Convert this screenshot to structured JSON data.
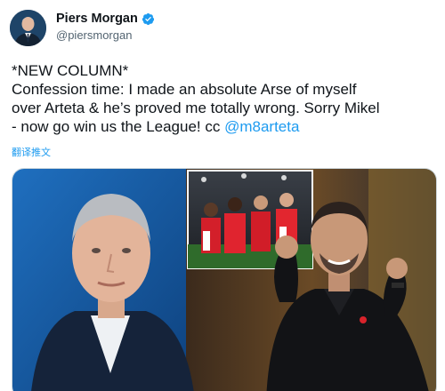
{
  "author": {
    "name": "Piers Morgan",
    "handle": "@piersmorgan",
    "verified_icon": "verified-badge-icon",
    "avatar_icon": "avatar-portrait"
  },
  "tweet": {
    "lines": [
      "*NEW COLUMN*",
      "Confession time: I made an absolute Arse of myself",
      "over Arteta & he’s proved me totally wrong. Sorry Mikel",
      "- now go win us the League! cc "
    ],
    "mention": "@m8arteta",
    "translate_label": "翻译推文"
  },
  "media": {
    "description_icon": "column-promo-image"
  },
  "colors": {
    "link": "#1d9bf0",
    "text": "#0f1419",
    "secondary": "#536471",
    "verified": "#1d9bf0"
  }
}
